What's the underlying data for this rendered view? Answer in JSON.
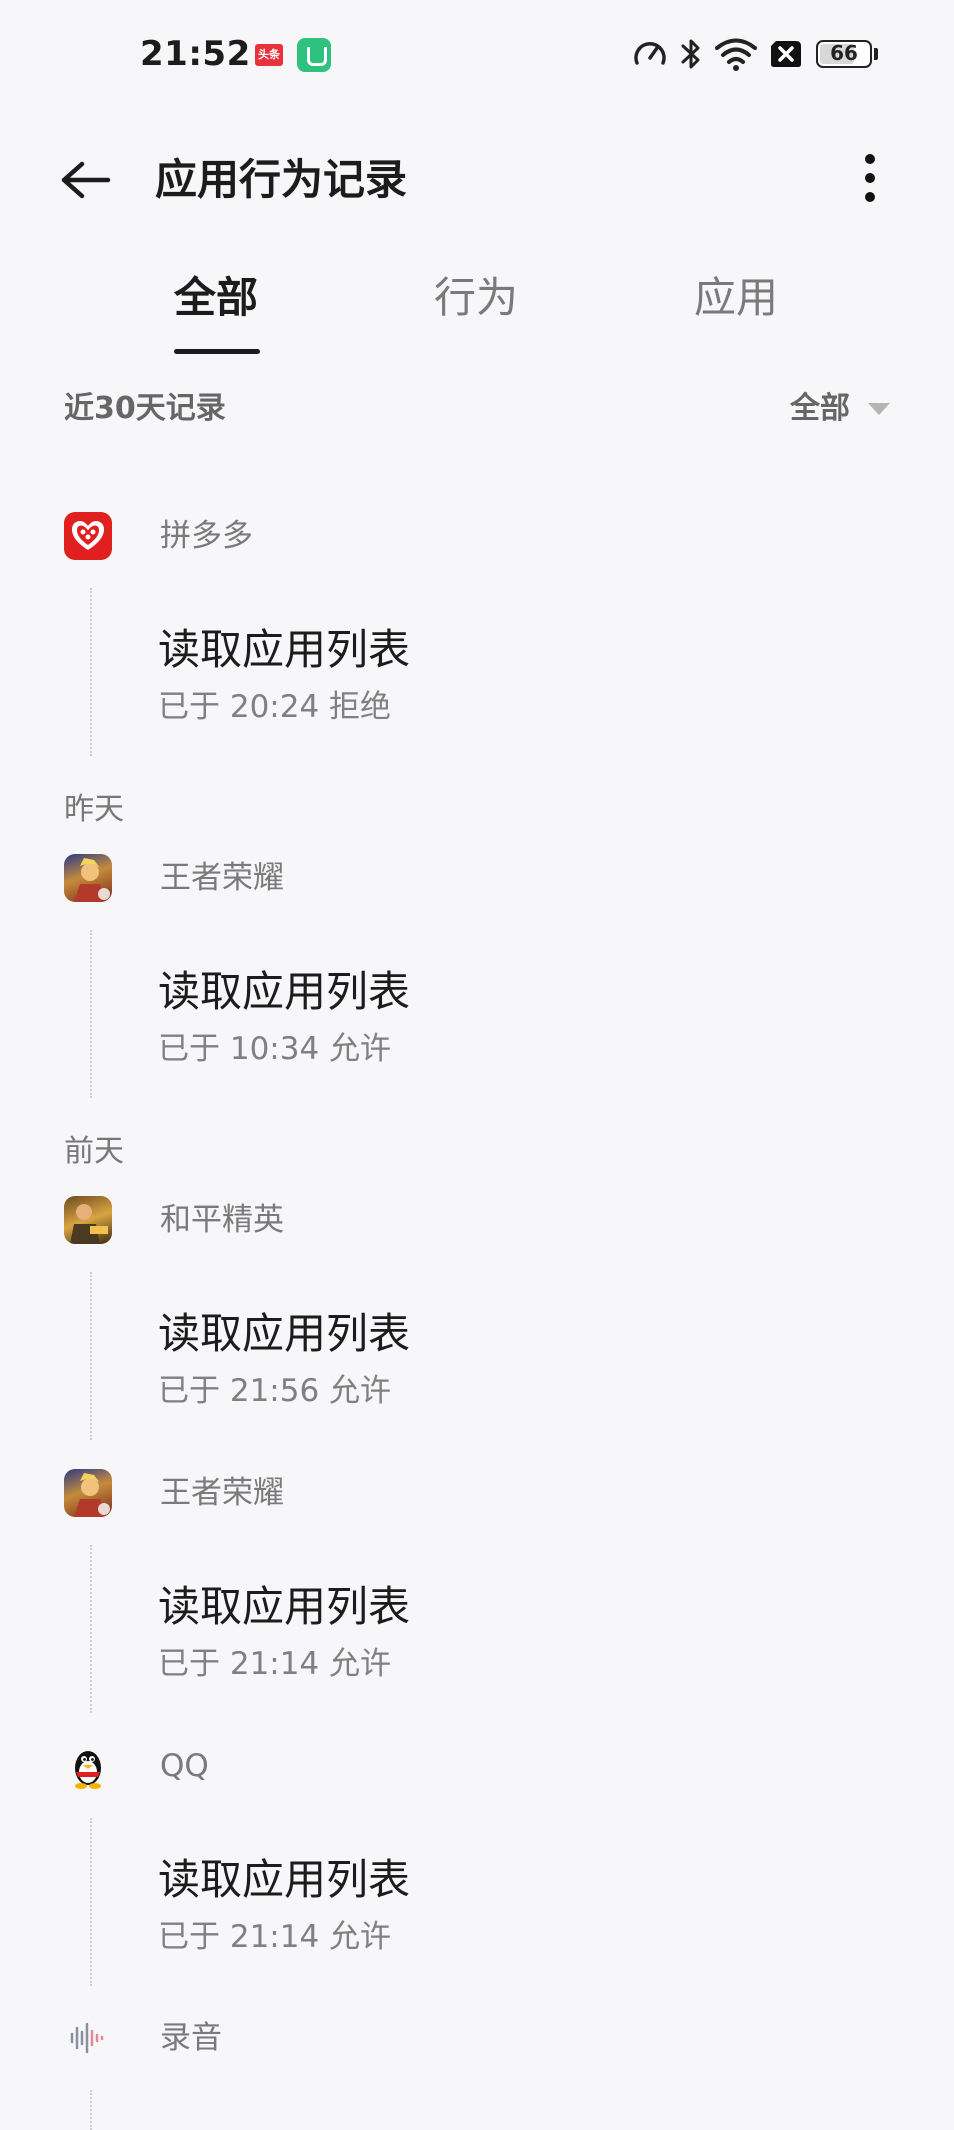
{
  "status_bar": {
    "time": "21:52",
    "notification_badge": "头条",
    "battery_level": "66",
    "icons": [
      "speedometer-icon",
      "bluetooth-icon",
      "wifi-icon",
      "no-sim-icon",
      "battery-icon"
    ]
  },
  "header": {
    "title": "应用行为记录",
    "back_icon": "arrow-left-icon",
    "more_icon": "more-vertical-icon"
  },
  "tabs": [
    {
      "label": "全部",
      "active": true
    },
    {
      "label": "行为",
      "active": false
    },
    {
      "label": "应用",
      "active": false
    }
  ],
  "subheader": {
    "label": "近30天记录",
    "filter_value": "全部"
  },
  "records": [
    {
      "day": "",
      "app": "拼多多",
      "icon": "pinduoduo-icon",
      "title": "读取应用列表",
      "detail": "已于 20:24 拒绝"
    },
    {
      "day": "昨天",
      "app": "王者荣耀",
      "icon": "honor-of-kings-icon",
      "title": "读取应用列表",
      "detail": "已于 10:34 允许"
    },
    {
      "day": "前天",
      "app": "和平精英",
      "icon": "peacekeeper-elite-icon",
      "title": "读取应用列表",
      "detail": "已于 21:56 允许"
    },
    {
      "day": "",
      "app": "王者荣耀",
      "icon": "honor-of-kings-icon",
      "title": "读取应用列表",
      "detail": "已于 21:14 允许"
    },
    {
      "day": "",
      "app": "QQ",
      "icon": "qq-penguin-icon",
      "title": "读取应用列表",
      "detail": "已于 21:14 允许"
    },
    {
      "day": "",
      "app": "录音",
      "icon": "sound-recorder-icon",
      "title": "",
      "detail": ""
    }
  ],
  "colors": {
    "background": "#f7f7f9",
    "text_primary": "#1c1c1c",
    "text_secondary": "#7a7a7a",
    "pinduoduo_red": "#e0201e",
    "toutiao_red": "#e8323d",
    "notification_green": "#2ec27e"
  }
}
